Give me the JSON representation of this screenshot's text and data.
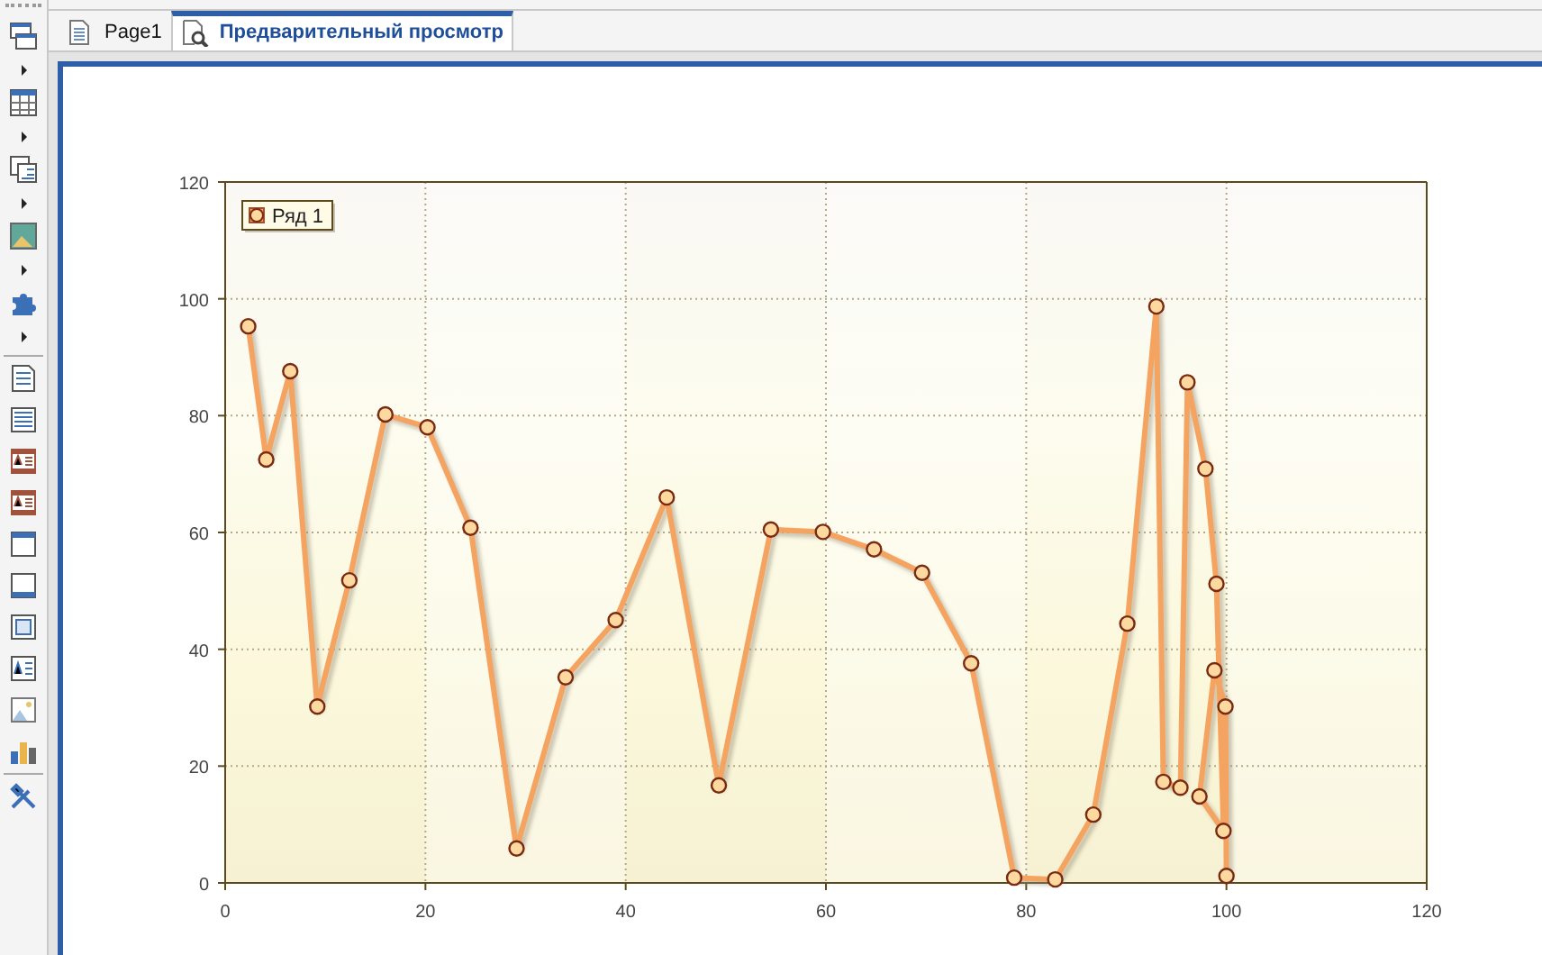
{
  "tabs": [
    {
      "label": "Page1",
      "selected": false,
      "kind": "page"
    },
    {
      "label": "Предварительный просмотр",
      "selected": true,
      "kind": "preview"
    }
  ],
  "chart": {
    "chart_data": {
      "type": "line",
      "grid": true,
      "x": [
        2.3,
        4.1,
        6.5,
        9.2,
        12.4,
        16.0,
        20.2,
        24.5,
        29.1,
        34.0,
        39.0,
        44.1,
        49.3,
        54.5,
        59.7,
        64.8,
        69.6,
        74.5,
        78.8,
        82.9,
        86.7,
        90.1,
        93.0,
        93.7,
        95.4,
        96.1,
        97.9,
        99.0,
        99.7,
        97.3,
        98.8,
        99.9,
        100.0
      ],
      "series": [
        {
          "name": "Ряд 1",
          "color": "#f4a460",
          "marker": "circle",
          "values": [
            95.3,
            72.5,
            87.6,
            30.2,
            51.8,
            80.2,
            78.0,
            60.8,
            5.9,
            35.2,
            45.0,
            66.0,
            16.7,
            60.5,
            60.1,
            57.1,
            53.1,
            37.6,
            0.9,
            0.6,
            11.7,
            44.4,
            98.7,
            17.3,
            16.3,
            85.7,
            70.9,
            51.2,
            8.9,
            14.8,
            36.4,
            30.2,
            1.2
          ]
        }
      ],
      "xlim": [
        0,
        120
      ],
      "ylim": [
        0,
        120
      ],
      "xticks": [
        0,
        20,
        40,
        60,
        80,
        100,
        120
      ],
      "yticks": [
        0,
        20,
        40,
        60,
        80,
        100,
        120
      ]
    }
  }
}
